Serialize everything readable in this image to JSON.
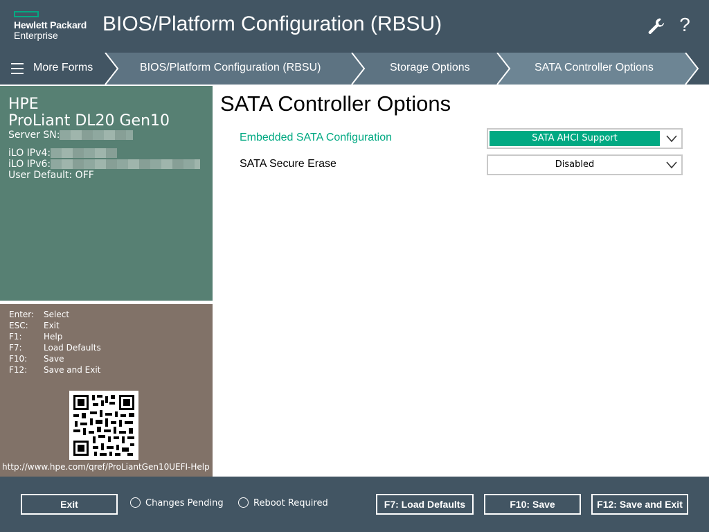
{
  "header": {
    "logo_line1": "Hewlett Packard",
    "logo_line2": "Enterprise",
    "title": "BIOS/Platform Configuration (RBSU)",
    "icons": [
      "wrench-icon"
    ],
    "help_label": "?"
  },
  "breadcrumb": {
    "more_forms": "More Forms",
    "items": [
      {
        "label": "BIOS/Platform Configuration (RBSU)"
      },
      {
        "label": "Storage Options"
      },
      {
        "label": "SATA Controller Options"
      }
    ]
  },
  "server_info": {
    "brand": "HPE",
    "model": "ProLiant DL20 Gen10",
    "serial_label": "Server SN:",
    "ipv4_label": "iLO IPv4:",
    "ipv6_label": "iLO IPv6:",
    "user_default": "User Default: OFF"
  },
  "help": {
    "keys": [
      {
        "key": "Enter:",
        "action": "Select"
      },
      {
        "key": "ESC:",
        "action": "Exit"
      },
      {
        "key": "F1:",
        "action": "Help"
      },
      {
        "key": "F7:",
        "action": "Load Defaults"
      },
      {
        "key": "F10:",
        "action": "Save"
      },
      {
        "key": "F12:",
        "action": "Save and Exit"
      }
    ],
    "url": "http://www.hpe.com/qref/ProLiantGen10UEFI-Help"
  },
  "main": {
    "title": "SATA Controller Options",
    "options": [
      {
        "label": "Embedded SATA Configuration",
        "value": "SATA AHCI Support",
        "selected": true
      },
      {
        "label": "SATA Secure Erase",
        "value": "Disabled",
        "selected": false
      }
    ]
  },
  "footer": {
    "exit": "Exit",
    "changes_pending": "Changes Pending",
    "reboot_required": "Reboot Required",
    "load_defaults": "F7: Load Defaults",
    "save": "F10: Save",
    "save_exit": "F12: Save and Exit"
  },
  "colors": {
    "header_bg": "#425563",
    "accent": "#01a982",
    "info_panel": "#578073",
    "help_panel": "#817268",
    "crumb_active": "#6d8594",
    "crumb_mid": "#5d7382"
  }
}
